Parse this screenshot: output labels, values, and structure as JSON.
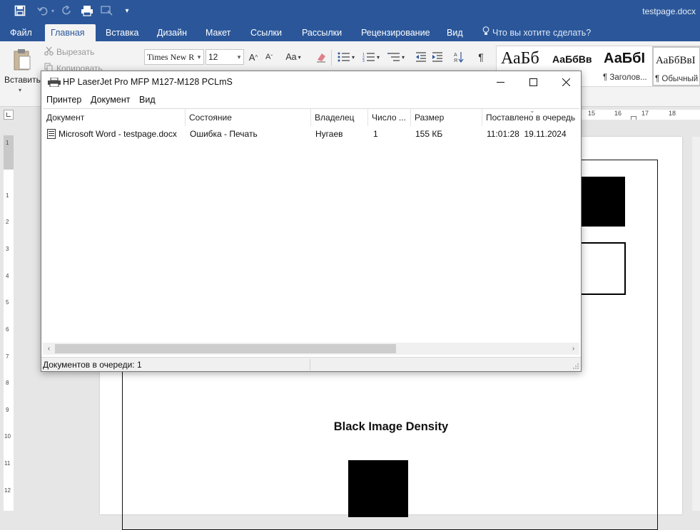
{
  "word": {
    "doc_title": "testpage.docx",
    "tabs": [
      {
        "label": "Файл",
        "active": false
      },
      {
        "label": "Главная",
        "active": true
      },
      {
        "label": "Вставка",
        "active": false
      },
      {
        "label": "Дизайн",
        "active": false
      },
      {
        "label": "Макет",
        "active": false
      },
      {
        "label": "Ссылки",
        "active": false
      },
      {
        "label": "Рассылки",
        "active": false
      },
      {
        "label": "Рецензирование",
        "active": false
      },
      {
        "label": "Вид",
        "active": false
      }
    ],
    "tell_me": "Что вы хотите сделать?",
    "ribbon": {
      "paste_label": "Вставить",
      "cut_label": "Вырезать",
      "copy_label": "Копировать",
      "font_name": "Times New R",
      "font_size": "12",
      "change_case": "Aa",
      "styles": [
        {
          "sample": "АаБб",
          "name": ""
        },
        {
          "sample": "АаБбВв",
          "name": ""
        },
        {
          "sample": "АаБбI",
          "name": "¶ Заголов..."
        },
        {
          "sample": "АаБбВвI",
          "name": "¶ Обычный"
        }
      ]
    }
  },
  "document": {
    "ruler_numbers": [
      "15",
      "16",
      "17",
      "18"
    ],
    "vruler_numbers": [
      "1",
      "1",
      "2",
      "3",
      "4",
      "5",
      "6",
      "7",
      "8",
      "9",
      "10",
      "11",
      "12"
    ],
    "heading": "Black Image Density"
  },
  "queue": {
    "title": "HP LaserJet Pro MFP M127-M128 PCLmS",
    "menu": [
      "Принтер",
      "Документ",
      "Вид"
    ],
    "columns": [
      "Документ",
      "Состояние",
      "Владелец",
      "Число ...",
      "Размер",
      "Поставлено в очередь"
    ],
    "jobs": [
      {
        "document": "Microsoft Word - testpage.docx",
        "status": "Ошибка - Печать",
        "owner": "Нугаев",
        "pages": "1",
        "size": "155 КБ",
        "submitted": "11:01:28  19.11.2024"
      }
    ],
    "status_text": "Документов в очереди: 1"
  }
}
